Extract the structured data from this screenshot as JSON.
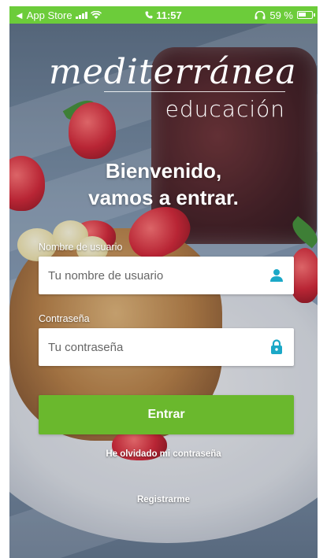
{
  "status_bar": {
    "back_app": "◄ App Store",
    "time": "11:57",
    "battery": "59 %",
    "signal_icon": "signal-bars-icon",
    "wifi_icon": "wifi-icon",
    "phone_icon": "phone-icon",
    "headphones_icon": "headphones-icon",
    "battery_icon": "battery-icon"
  },
  "logo": {
    "main": "mediterránea",
    "sub": "educación"
  },
  "welcome": {
    "line1": "Bienvenido,",
    "line2": "vamos a entrar."
  },
  "form": {
    "username_label": "Nombre de usuario",
    "username_placeholder": "Tu nombre de usuario",
    "password_label": "Contraseña",
    "password_placeholder": "Tu contraseña",
    "user_icon": "user-icon",
    "lock_icon": "lock-icon"
  },
  "actions": {
    "login_button": "Entrar",
    "forgot_password": "He olvidado mi contraseña",
    "register": "Registrarme"
  },
  "colors": {
    "status_green": "#6ccc3a",
    "button_green": "#6ab82d",
    "icon_teal": "#1ba8c7"
  }
}
